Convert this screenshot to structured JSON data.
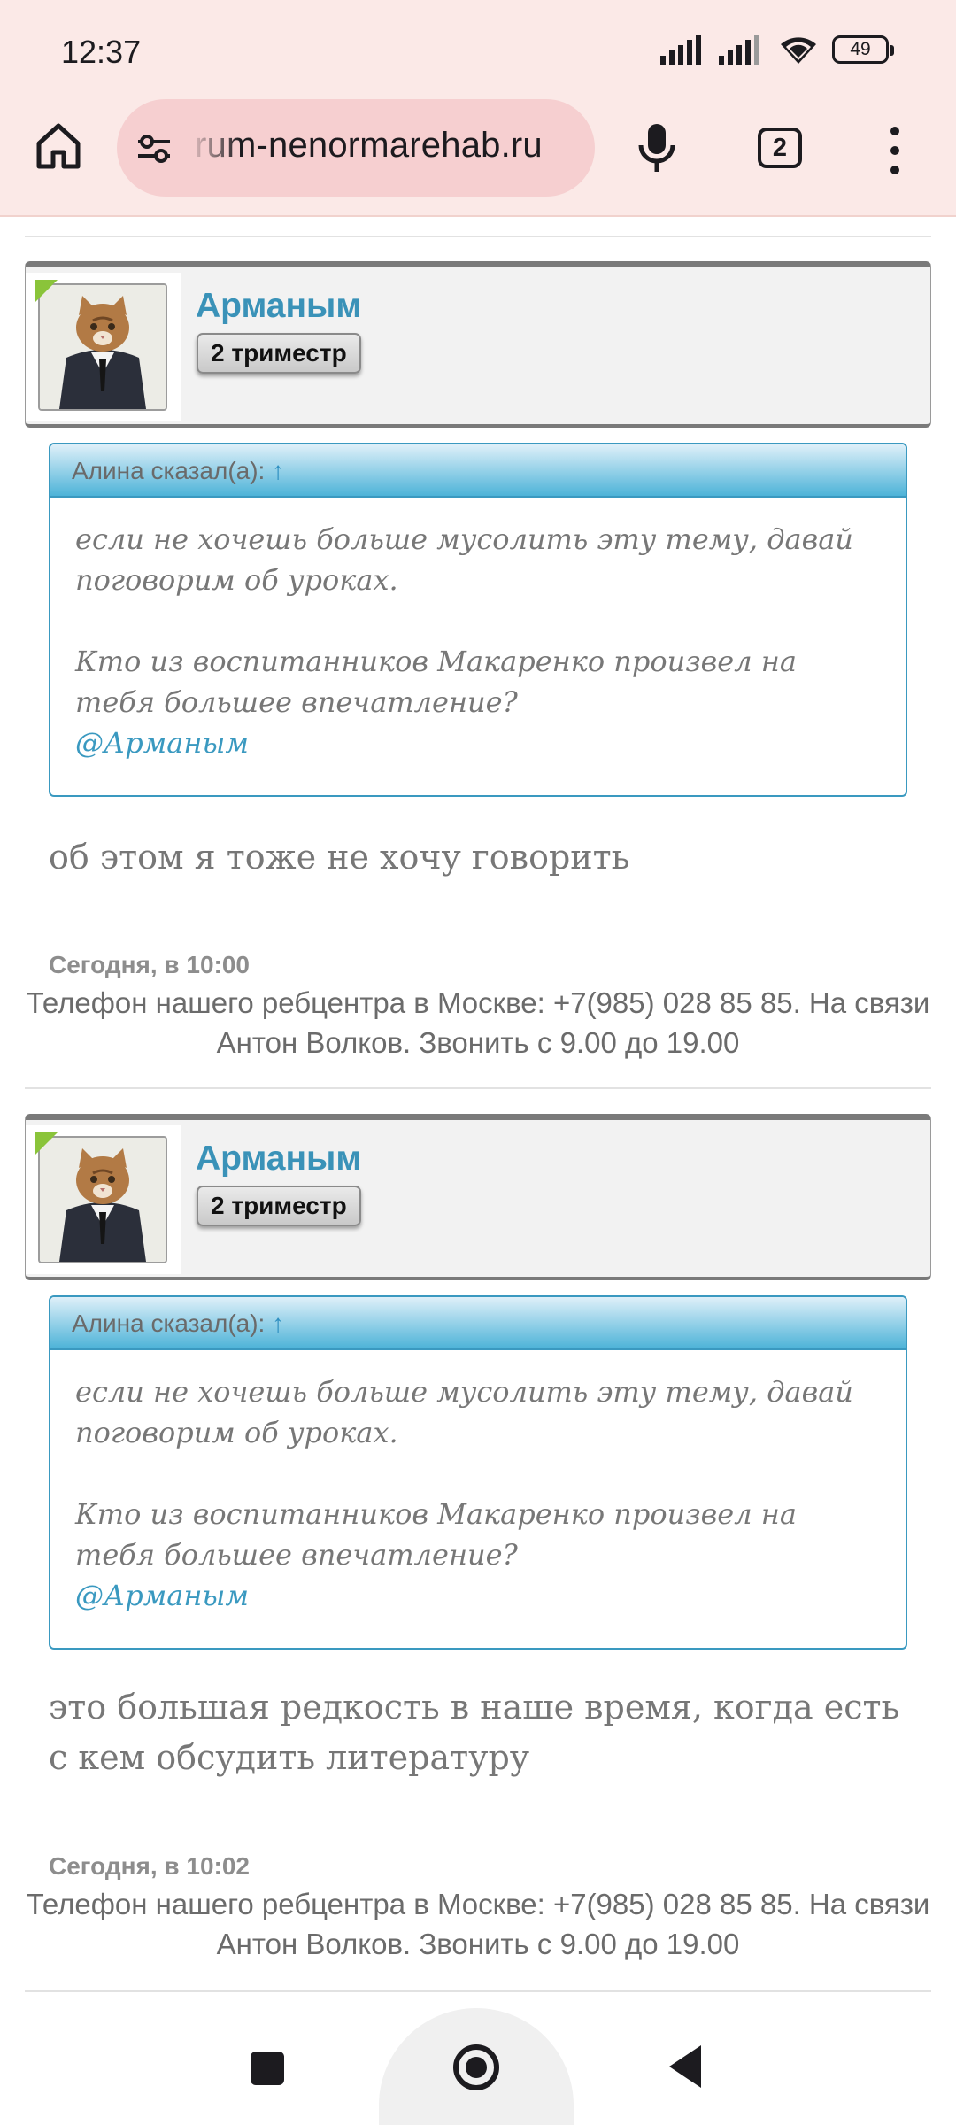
{
  "status_bar": {
    "time": "12:37",
    "battery": "49"
  },
  "browser": {
    "url": "rum-nenormarehab.ru",
    "tab_count": "2"
  },
  "posts": [
    {
      "author": "Арманым",
      "rank": "2 триместр",
      "quote": {
        "header": "Алина сказал(а):",
        "arrow": "↑",
        "line1": "если не хочешь больше мусолить эту тему, давай поговорим об уроках.",
        "line2": "Кто из воспитанников Макаренко произвел на тебя большее впечатление?",
        "mention": "@Арманым"
      },
      "text": "об этом я тоже не хочу говорить",
      "date": "Сегодня, в 10:00",
      "signature": "Телефон нашего ребцентра в Москве: +7(985) 028 85 85. На связи Антон Волков. Звонить с 9.00 до 19.00"
    },
    {
      "author": "Арманым",
      "rank": "2 триместр",
      "quote": {
        "header": "Алина сказал(а):",
        "arrow": "↑",
        "line1": "если не хочешь больше мусолить эту тему, давай поговорим об уроках.",
        "line2": "Кто из воспитанников Макаренко произвел на тебя большее впечатление?",
        "mention": "@Арманым"
      },
      "text": "это большая редкость в наше время, когда есть с кем обсудить литературу",
      "date": "Сегодня, в 10:02",
      "signature": "Телефон нашего ребцентра в Москве: +7(985) 028 85 85. На связи Антон Волков. Звонить с 9.00 до 19.00"
    }
  ],
  "colors": {
    "toolbar_bg": "#fbe9e7",
    "url_pill": "#f6cfd0",
    "username": "#3a92b8",
    "quote_border": "#3a99c0",
    "online": "#8ac43a"
  },
  "icons": [
    "signal-icon",
    "wifi-icon",
    "battery-icon",
    "home-icon",
    "site-settings-icon",
    "mic-icon",
    "tabs-icon",
    "more-menu-icon",
    "nav-recents-icon",
    "nav-home-icon",
    "nav-back-icon"
  ]
}
